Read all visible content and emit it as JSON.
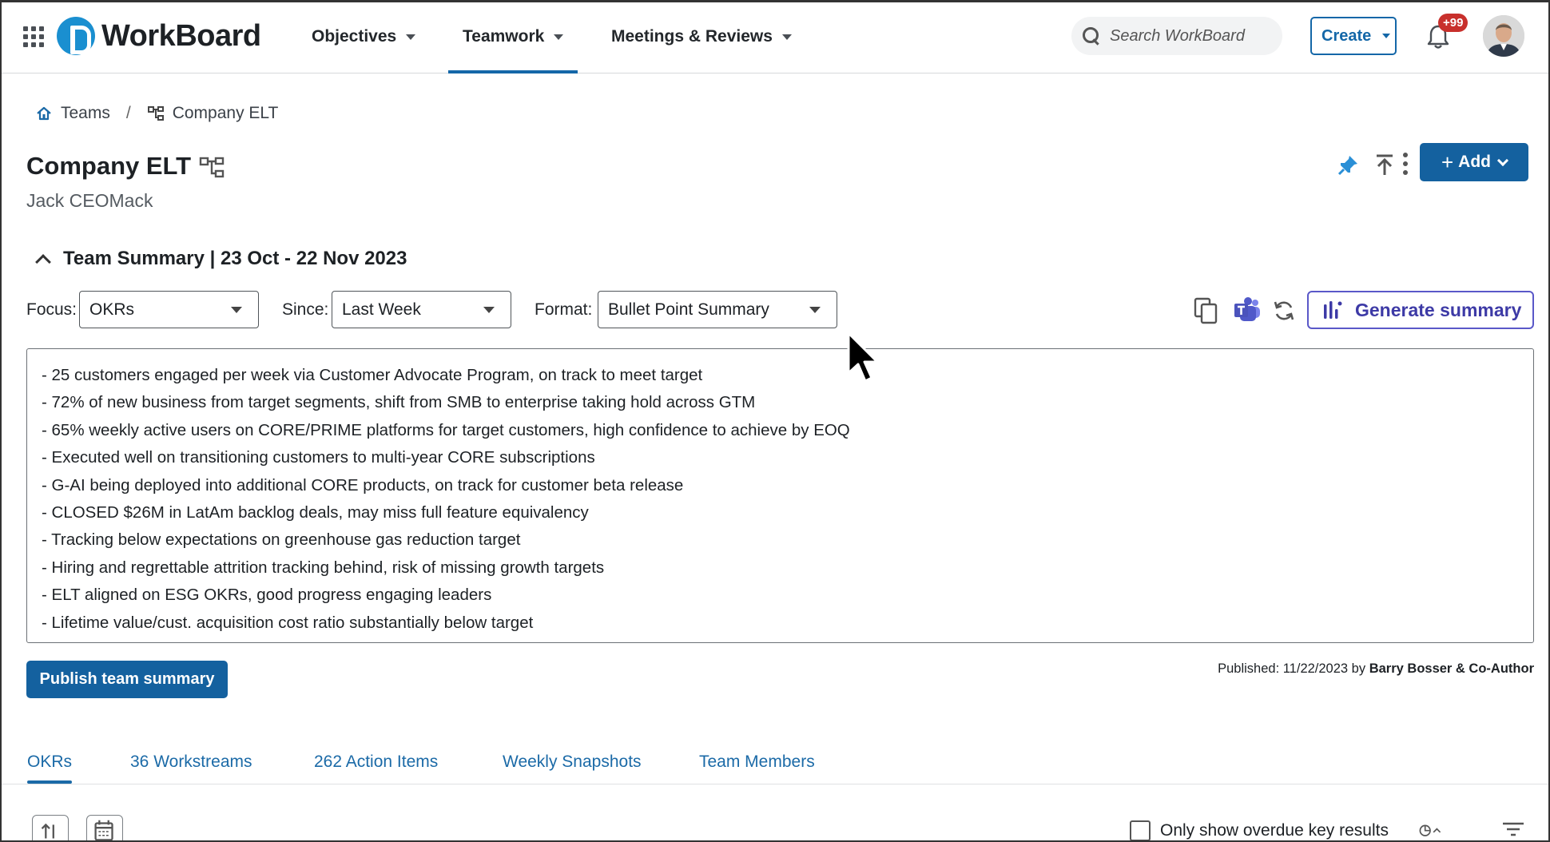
{
  "app": {
    "name": "WorkBoard"
  },
  "nav": {
    "items": [
      {
        "label": "Objectives"
      },
      {
        "label": "Teamwork"
      },
      {
        "label": "Meetings & Reviews"
      }
    ],
    "active": "Teamwork",
    "search_placeholder": "Search WorkBoard",
    "create_label": "Create",
    "notification_count": "+99"
  },
  "breadcrumb": {
    "home": "Teams",
    "current": "Company ELT"
  },
  "header": {
    "title": "Company ELT",
    "owner": "Jack CEOMack",
    "add_label": "Add"
  },
  "summary": {
    "heading": "Team Summary | 23 Oct - 22 Nov 2023",
    "focus_label": "Focus:",
    "focus_value": "OKRs",
    "since_label": "Since:",
    "since_value": "Last Week",
    "format_label": "Format:",
    "format_value": "Bullet Point Summary",
    "generate_label": "Generate summary",
    "lines": [
      "- 25 customers engaged per week via Customer Advocate Program, on track to meet target",
      "- 72% of new business from target segments, shift from SMB to enterprise taking hold across GTM",
      "- 65% weekly active users on CORE/PRIME platforms for target customers, high confidence to achieve by EOQ",
      "- Executed well on transitioning customers to multi-year CORE subscriptions",
      "- G-AI being deployed into additional CORE products, on track for customer beta release",
      "- CLOSED $26M in LatAm backlog deals, may miss full feature equivalency",
      "- Tracking below expectations on greenhouse gas reduction target",
      "- Hiring and regrettable attrition tracking behind, risk of missing growth targets",
      "- ELT aligned on ESG OKRs, good progress engaging leaders",
      "- Lifetime value/cust. acquisition cost ratio substantially below target"
    ],
    "publish_label": "Publish team summary",
    "published_prefix": "Published: 11/22/2023 by",
    "published_by": "Barry Bosser & Co-Author"
  },
  "tabs": [
    {
      "label": "OKRs"
    },
    {
      "label": "36 Workstreams"
    },
    {
      "label": "262 Action Items"
    },
    {
      "label": "Weekly Snapshots"
    },
    {
      "label": "Team Members"
    }
  ],
  "active_tab": "OKRs",
  "toolbar": {
    "overdue_label": "Only show overdue key results"
  },
  "colors": {
    "brand_blue": "#14619f",
    "logo_blue": "#1a8fd0",
    "generate_purple": "#5a58c8",
    "badge_red": "#c8302c",
    "tab_blue": "#1b6aa7"
  }
}
